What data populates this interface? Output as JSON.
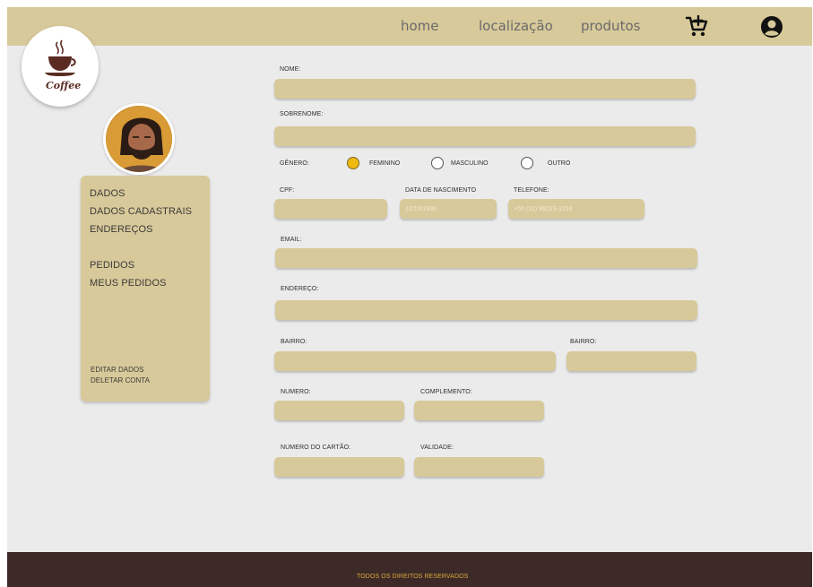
{
  "nav": {
    "home": "home",
    "location": "localização",
    "products": "produtos",
    "cart_icon": "cart-plus-icon",
    "user_icon": "user-circle-icon"
  },
  "logo": {
    "text": "Coffee"
  },
  "sidebar": {
    "items": [
      "DADOS",
      "DADOS CADASTRAIS",
      "ENDEREÇOS",
      "PEDIDOS",
      "MEUS PEDIDOS"
    ],
    "actions": [
      "EDITAR DADOS",
      "DELETAR CONTA"
    ]
  },
  "form": {
    "nome_label": "NOME:",
    "sobrenome_label": "SOBRENOME:",
    "genero_label": "GÊNERO:",
    "genero_options": [
      "FEMININO",
      "MASCULINO",
      "OUTRO"
    ],
    "genero_selected": "FEMININO",
    "cpf_label": "CPF:",
    "nascimento_label": "DATA DE NASCIMENTO",
    "nascimento_placeholder": "12/10/1990",
    "telefone_label": "TELEFONE:",
    "telefone_placeholder": "+55 (12) 99123-1234",
    "email_label": "EMAIL:",
    "endereco_label": "ENDEREÇO:",
    "bairro_label": "BAIRRO:",
    "bairro2_label": "BAIRRO:",
    "numero_label": "NUMERO:",
    "complemento_label": "COMPLEMENTO:",
    "cartao_label": "NUMERO DO CARTÃO:",
    "validade_label": "VALIDADE:"
  },
  "footer": {
    "text": "TODOS OS DIREITOS RESERVADOS"
  },
  "colors": {
    "topbar": "#d8c99a",
    "field": "#d8c99a",
    "background": "#ebebeb",
    "footer": "#3d2a28",
    "radio_selected": "#f0b90f"
  }
}
